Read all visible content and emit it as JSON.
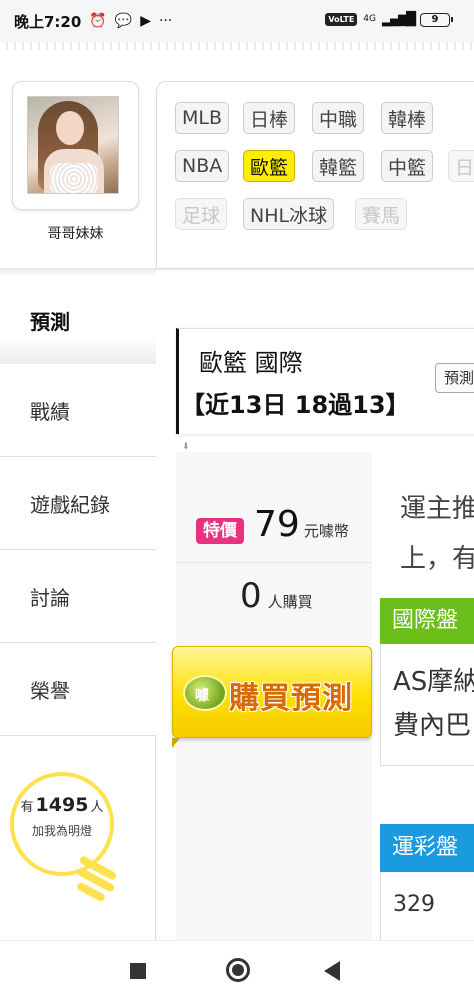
{
  "status_bar": {
    "time": "晚上7:20",
    "dots": "···",
    "volte": "VoLTE",
    "network": "4G",
    "battery": "9"
  },
  "profile": {
    "name": "哥哥妹妹"
  },
  "menu": {
    "items": [
      {
        "label": "預測"
      },
      {
        "label": "戰績"
      },
      {
        "label": "遊戲紀錄"
      },
      {
        "label": "討論"
      },
      {
        "label": "榮譽"
      }
    ]
  },
  "fans": {
    "prefix": "有",
    "count": "1495",
    "suffix": "人",
    "cta": "加我為明燈"
  },
  "sports": {
    "active": "歐籃",
    "row1": [
      "MLB",
      "日棒",
      "中職",
      "韓棒"
    ],
    "row2": [
      "NBA",
      "歐籃",
      "韓籃",
      "中籃",
      "日"
    ],
    "row3": [
      "足球",
      "NHL冰球",
      "賽馬"
    ]
  },
  "prediction": {
    "title": "歐籃 國際",
    "record": "【近13日 18過13】",
    "button_label": "預測"
  },
  "purchase": {
    "tag": "特價",
    "price": "79",
    "price_unit": "元噱幣",
    "buyers": "0",
    "buyers_unit": "人購買",
    "button_label": "購買預測",
    "button_icon_text": "噱"
  },
  "description": {
    "line1": "運主推",
    "line2": "上，有"
  },
  "card_international": {
    "header": "國際盤",
    "line1": "AS摩納",
    "line2": "費內巴"
  },
  "card_lottery": {
    "header": "運彩盤",
    "value": "329"
  }
}
